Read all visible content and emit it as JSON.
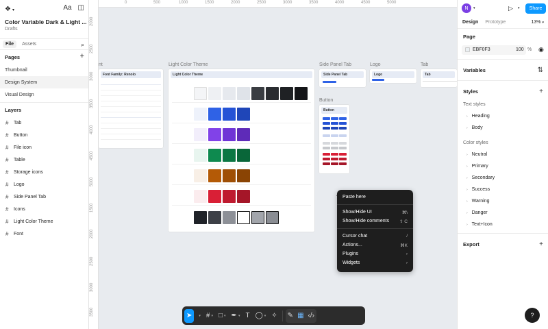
{
  "file": {
    "title": "Color Variable Dark & Light ...",
    "subtitle": "Drafts"
  },
  "left_tabs": [
    "File",
    "Assets"
  ],
  "pages": {
    "header": "Pages",
    "items": [
      "Thumbnail",
      "Design System",
      "Visual Design"
    ],
    "selected": "Design System"
  },
  "layers": {
    "header": "Layers",
    "items": [
      "Tab",
      "Button",
      "File icon",
      "Table",
      "Storage icons",
      "Logo",
      "Side Panel Tab",
      "Icons",
      "Light Color Theme",
      "Font"
    ]
  },
  "ruler": {
    "top": [
      "0",
      "500",
      "1000",
      "1500",
      "2000",
      "2500",
      "3000",
      "3500",
      "4000",
      "4500",
      "5000"
    ],
    "left": [
      "2000",
      "2500",
      "3000",
      "3500",
      "4000",
      "4500",
      "5000",
      "1500",
      "2000",
      "2500",
      "3000",
      "3500"
    ]
  },
  "frames": {
    "font": "nt",
    "font_header": "Font Family: Renolo",
    "light_theme": "Light Color Theme",
    "light_theme_header": "Light Color Theme",
    "side_panel_tab": "Side Panel Tab",
    "side_panel_tab_header": "Side Panel Tab",
    "logo": "Logo",
    "logo_header": "Logo",
    "tab": "Tab",
    "tab_header": "Tab",
    "button": "Button",
    "button_header": "Button"
  },
  "context_menu": {
    "items": [
      {
        "label": "Paste here",
        "shortcut": ""
      },
      {
        "label": "Show/Hide UI",
        "shortcut": "⌘\\"
      },
      {
        "label": "Show/Hide comments",
        "shortcut": "⇧ C"
      },
      {
        "label": "Cursor chat",
        "shortcut": "/"
      },
      {
        "label": "Actions...",
        "shortcut": "⌘K"
      },
      {
        "label": "Plugins",
        "shortcut": "›"
      },
      {
        "label": "Widgets",
        "shortcut": "›"
      }
    ]
  },
  "right_panel": {
    "avatar_initial": "N",
    "share_label": "Share",
    "tabs": [
      "Design",
      "Prototype"
    ],
    "zoom": "13%",
    "page_section": "Page",
    "page_color_hex": "EBF0F3",
    "page_opacity": "100",
    "page_opacity_unit": "%",
    "variables_section": "Variables",
    "styles_section": "Styles",
    "text_styles_head": "Text styles",
    "text_styles": [
      "Heading",
      "Body"
    ],
    "color_styles_head": "Color styles",
    "color_styles": [
      "Neutral",
      "Primary",
      "Secondary",
      "Success",
      "Warning",
      "Danger",
      "Text+Icon"
    ],
    "export_section": "Export",
    "help": "?"
  },
  "colors": {
    "accent": "#0d99ff",
    "avatar": "#7b3fe4",
    "menu_bg": "#1e1e1e",
    "page_bg": "#EBF0F3"
  }
}
